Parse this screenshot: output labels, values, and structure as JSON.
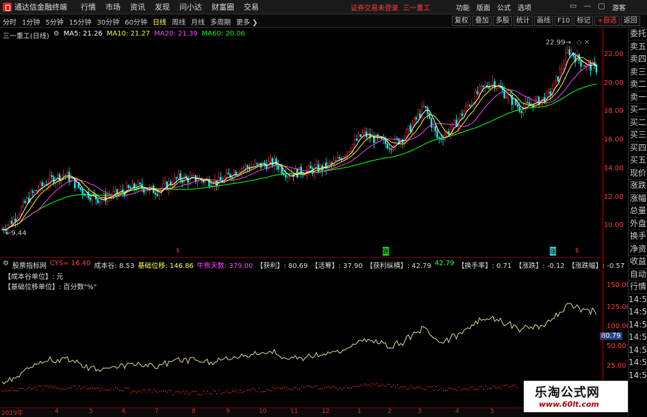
{
  "app": {
    "name": "通达信金融终端",
    "alert": "证券交易未登录",
    "stock_name": "三一重工",
    "guest": "游客"
  },
  "menu": [
    "行情",
    "市场",
    "资讯",
    "发现",
    "问小达",
    "财富圈",
    "交易"
  ],
  "right_menu": [
    "功能",
    "版面",
    "公式",
    "选项"
  ],
  "window_buttons": [
    "▭",
    "—",
    "▢",
    "✕"
  ],
  "periods": [
    "分时",
    "1分钟",
    "5分钟",
    "15分钟",
    "30分钟",
    "60分钟",
    "日线",
    "周线",
    "月线",
    "多周期",
    "更多 ❯"
  ],
  "active_period": "日线",
  "tools": [
    "复权",
    "叠加",
    "多股",
    "统计",
    "画线",
    "F10",
    "标记",
    "+自选",
    "返回"
  ],
  "main_header": {
    "title": "三一重工(日线)",
    "ma5": "MA5: 21.26",
    "ma10": "MA10: 21.27",
    "ma20": "MA20: 21.39",
    "ma60": "MA60: 20.06"
  },
  "price_axis": [
    "22.00",
    "20.00",
    "18.00",
    "16.00",
    "14.00",
    "12.00",
    "10.00"
  ],
  "labels": {
    "high": "22.99",
    "low": "9.44"
  },
  "sub_header": {
    "name": "股票指标网",
    "cys": "CYS= 16.40",
    "cbg": "成本谷: 8.53",
    "jcwy": "基础位移: 146.86",
    "nsts": "牛熊天数: 379.00",
    "hl": "【获利】: 80.69",
    "hc": "【活筹】: 37.90",
    "hlzf": "【获利纵横】: 42.79",
    "hlzf2": "42.79",
    "hsl": "【换手率】: 0.71",
    "zd": "【涨跌】: -0.12",
    "zdf": "【涨跌幅】: -0.57"
  },
  "sub_notes": [
    "【成本谷单位】: 元",
    "【基础位移单位】: 百分数\"%\""
  ],
  "sub_axis": [
    "150.00",
    "125.00",
    "100.00",
    "80.79",
    "50.00",
    "25.00"
  ],
  "markers": {
    "m1": "$",
    "m2": "跌",
    "m3": "涨",
    "m4": "$"
  },
  "right_panel": [
    "委托",
    "卖五",
    "卖四",
    "卖三",
    "卖二",
    "卖一",
    "买一",
    "买二",
    "买三",
    "买四",
    "买五",
    "现价",
    "涨跌",
    "涨幅",
    "总量",
    "外盘",
    "换手",
    "净资",
    "收益",
    "自动",
    "行情",
    "14:50",
    "14:50",
    "14:50",
    "14:50",
    "14:50",
    "14:50",
    "14:50"
  ],
  "bottom_axis": [
    "2019年",
    "4",
    "5",
    "6",
    "7",
    "8",
    "9",
    "10",
    "11",
    "12",
    "1",
    "2",
    "3",
    "4",
    "5"
  ],
  "watermark": {
    "line1": "乐淘公式网",
    "line2": "www.60lt.com"
  },
  "colors": {
    "ma5": "#ffffff",
    "ma10": "#ffff00",
    "ma20": "#ff44ff",
    "ma60": "#00ff00",
    "up": "#ff3333",
    "down": "#00ffff",
    "sub_line": "#e8e0a0",
    "sub_red": "#ff3030"
  }
}
